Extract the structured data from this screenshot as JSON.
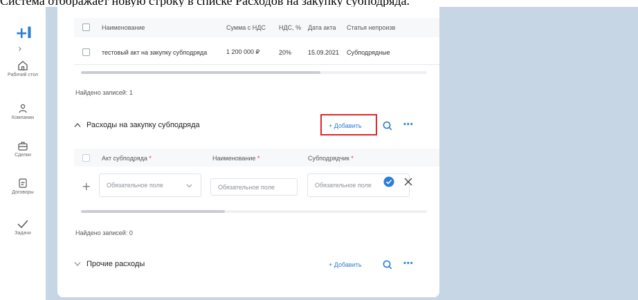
{
  "caption": "Система отображает новую строку в списке Расходов на закупку субподряда.",
  "sidebar": {
    "logo": "+I",
    "expand": "›",
    "items": [
      {
        "label": "Рабочий стол",
        "icon": "home-icon"
      },
      {
        "label": "Компании",
        "icon": "users-icon"
      },
      {
        "label": "Сделки",
        "icon": "briefcase-icon"
      },
      {
        "label": "Договоры",
        "icon": "document-icon"
      },
      {
        "label": "Задачи",
        "icon": "check-icon"
      }
    ]
  },
  "table1": {
    "headers": [
      "Наименование",
      "Сумма с НДС",
      "НДС, %",
      "Дата акта",
      "Статья непроизв"
    ],
    "rows": [
      [
        "тестовый акт на закупку субподряда",
        "1 200 000 ₽",
        "20%",
        "15.09.2021",
        "Субподрядные"
      ]
    ],
    "found": "Найдено записей: 1"
  },
  "section1": {
    "title": "Расходы на закупку субподряда",
    "toggle": "^",
    "add_label": "+ Добавить",
    "more": "•••"
  },
  "table2": {
    "headers": [
      "Акт субподряда",
      "Наименование",
      "Субподрядчик"
    ],
    "required_mark": "*",
    "new_row": {
      "add": "+",
      "act_placeholder": "Обязательное поле",
      "name_placeholder": "Обязательное поле",
      "contractor_placeholder": "Обязательное поле"
    },
    "found": "Найдено записей: 0"
  },
  "section2": {
    "title": "Прочие расходы",
    "toggle": "v",
    "add_label": "+ Добавить",
    "more": "•••"
  },
  "colors": {
    "accent": "#2a7ed8",
    "highlight": "#e0262c",
    "background": "#c6d6e5"
  }
}
